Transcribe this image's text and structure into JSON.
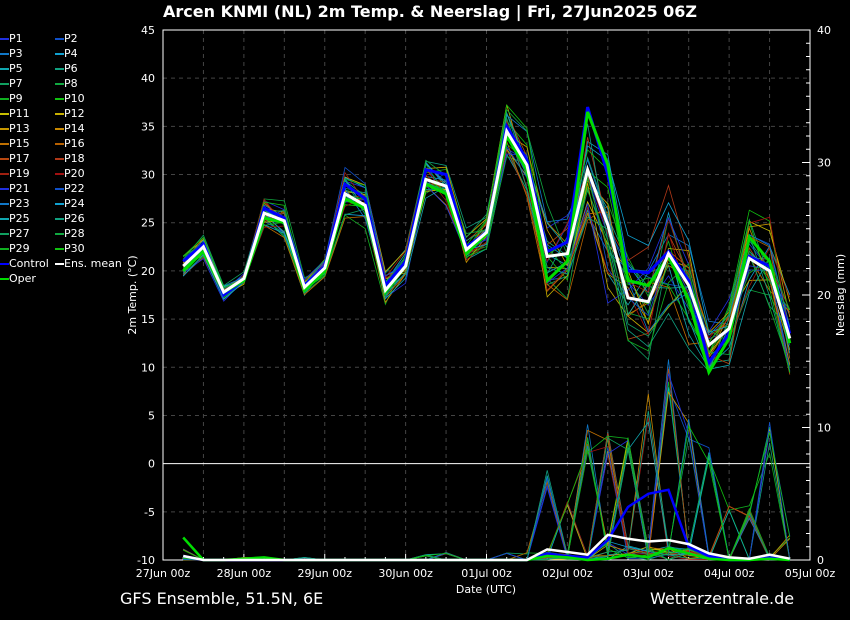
{
  "title": "Arcen KNMI  (NL)  2m Temp. & Neerslag | Fri, 27Jun2025 06Z",
  "footer": {
    "left": "GFS Ensemble, 51.5N, 6E",
    "right": "Wetterzentrale.de"
  },
  "chart_data": {
    "type": "line",
    "title": "Arcen KNMI  (NL)  2m Temp. & Neerslag | Fri, 27Jun2025 06Z",
    "xlabel": "Date (UTC)",
    "ylabel": "2m Temp. (°C)",
    "y2label": "Neerslag (mm)",
    "ylim": [
      -10,
      45
    ],
    "y2lim": [
      0,
      40
    ],
    "yticks": [
      "45",
      "40",
      "35",
      "30",
      "25",
      "20",
      "15",
      "10",
      "5",
      "0",
      "-5",
      "-10"
    ],
    "y2ticks": [
      "40",
      "30",
      "20",
      "10",
      "0"
    ],
    "xticks": [
      "27Jun 00z",
      "28Jun 00z",
      "29Jun 00z",
      "30Jun 00z",
      "01Jul 00z",
      "02Jul 00z",
      "03Jul 00z",
      "04Jul 00z",
      "05Jul 00z"
    ],
    "x_step_hours": 6,
    "x_start_hours": 6,
    "grid": true,
    "legend_position": "left",
    "series_colors": {
      "P1": "#2030e0",
      "P2": "#1050c8",
      "P3": "#1078c8",
      "P4": "#10a0d0",
      "P5": "#10a8b0",
      "P6": "#10a080",
      "P7": "#10a060",
      "P8": "#10a840",
      "P9": "#10b020",
      "P10": "#10c010",
      "P11": "#c8c000",
      "P12": "#c8b000",
      "P13": "#c89800",
      "P14": "#c88800",
      "P15": "#c07000",
      "P16": "#b86000",
      "P17": "#b84810",
      "P18": "#b03818",
      "P19": "#a02010",
      "P20": "#a01010",
      "P21": "#2030e0",
      "P22": "#1050c8",
      "P23": "#1078c8",
      "P24": "#10a0d0",
      "P25": "#10a8b0",
      "P26": "#10a080",
      "P27": "#10a060",
      "P28": "#10a840",
      "P29": "#10b020",
      "P30": "#10c010",
      "Control": "#0000ff",
      "Ens. mean": "#ffffff",
      "Oper": "#00dd00"
    },
    "legend": [
      "P1",
      "P2",
      "P3",
      "P4",
      "P5",
      "P6",
      "P7",
      "P8",
      "P9",
      "P10",
      "P11",
      "P12",
      "P13",
      "P14",
      "P15",
      "P16",
      "P17",
      "P18",
      "P19",
      "P20",
      "P21",
      "P22",
      "P23",
      "P24",
      "P25",
      "P26",
      "P27",
      "P28",
      "P29",
      "P30",
      "Control",
      "Ens. mean",
      "Oper"
    ],
    "temp": {
      "ens_mean": [
        20.5,
        22.5,
        17.8,
        19.2,
        26.0,
        25.2,
        18.3,
        20.3,
        28.0,
        26.8,
        18.0,
        20.5,
        29.5,
        28.8,
        22.2,
        24.0,
        34.5,
        31.0,
        21.5,
        21.8,
        30.5,
        24.8,
        17.2,
        16.8,
        21.8,
        18.5,
        12.3,
        14.0,
        21.3,
        20.0,
        13.0
      ],
      "control": [
        21.0,
        22.8,
        17.5,
        19.0,
        26.5,
        25.5,
        18.5,
        20.5,
        29.0,
        27.5,
        18.5,
        21.0,
        30.5,
        30.0,
        22.5,
        24.0,
        35.0,
        31.5,
        22.0,
        23.0,
        37.0,
        30.0,
        20.0,
        19.8,
        22.0,
        19.0,
        10.5,
        13.5,
        21.5,
        20.5,
        13.5
      ],
      "oper": [
        20.0,
        22.0,
        17.8,
        19.0,
        25.5,
        25.0,
        18.0,
        20.0,
        27.5,
        26.5,
        17.8,
        20.5,
        29.0,
        28.0,
        21.8,
        23.8,
        34.0,
        30.5,
        19.0,
        21.0,
        36.5,
        31.0,
        19.0,
        18.5,
        21.5,
        17.0,
        9.5,
        13.0,
        23.5,
        21.0,
        12.5
      ],
      "spread": [
        0.9,
        0.8,
        0.5,
        0.4,
        1.2,
        1.2,
        0.5,
        0.6,
        1.5,
        1.5,
        1.2,
        1.2,
        1.5,
        1.5,
        1.2,
        1.2,
        1.8,
        2.5,
        3.0,
        3.0,
        3.5,
        5.0,
        3.5,
        3.5,
        4.0,
        4.0,
        2.0,
        2.5,
        3.5,
        3.5,
        3.0
      ]
    },
    "precip": {
      "ens_mean": [
        0.3,
        0,
        0,
        0,
        0,
        0,
        0,
        0,
        0,
        0,
        0,
        0,
        0,
        0,
        0,
        0,
        0,
        0,
        0.8,
        0.6,
        0.4,
        1.9,
        1.6,
        1.4,
        1.5,
        1.2,
        0.5,
        0.2,
        0.1,
        0.4,
        0.1
      ],
      "control": [
        0.3,
        0,
        0,
        0,
        0,
        0,
        0,
        0,
        0,
        0,
        0,
        0,
        0,
        0,
        0,
        0,
        0,
        0,
        0.5,
        0.3,
        0.2,
        1.5,
        4.0,
        5.0,
        5.3,
        1.0,
        0.3,
        0,
        0,
        0.2,
        0
      ],
      "oper": [
        1.7,
        0,
        0,
        0.1,
        0.2,
        0,
        0,
        0,
        0,
        0,
        0,
        0,
        0,
        0,
        0,
        0,
        0,
        0,
        0.3,
        0.2,
        0,
        0.1,
        0.4,
        0.2,
        0.9,
        0.5,
        0.1,
        0,
        0,
        0.1,
        0
      ],
      "spread": [
        0.3,
        0,
        0,
        0.1,
        0.1,
        0,
        0.1,
        0,
        0,
        0,
        0,
        0,
        0.2,
        0.3,
        0,
        0,
        0.3,
        0.3,
        3,
        2,
        5,
        4,
        4,
        6,
        7,
        5,
        4,
        2,
        2,
        5,
        1
      ]
    }
  }
}
